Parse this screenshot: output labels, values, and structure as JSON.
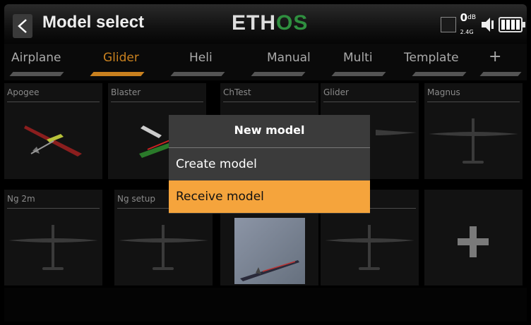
{
  "header": {
    "title": "Model select",
    "logo_main": "ETH",
    "logo_accent": "OS",
    "rf_value": "0",
    "rf_unit": "dB",
    "rf_band": "2.4G"
  },
  "tabs": [
    {
      "label": "Airplane",
      "active": false
    },
    {
      "label": "Glider",
      "active": true
    },
    {
      "label": "Heli",
      "active": false
    },
    {
      "label": "Manual",
      "active": false
    },
    {
      "label": "Multi",
      "active": false
    },
    {
      "label": "Template",
      "active": false
    },
    {
      "label": "+",
      "active": false
    }
  ],
  "models": [
    {
      "name": "Apogee",
      "image": "red-glider-icon"
    },
    {
      "name": "Blaster",
      "image": "green-glider-icon"
    },
    {
      "name": "ChTest",
      "image": "glider-silhouette-icon"
    },
    {
      "name": "Glider",
      "image": "glider-silhouette-icon"
    },
    {
      "name": "Magnus",
      "image": "glider-silhouette-icon"
    },
    {
      "name": "Ng 2m",
      "image": "glider-silhouette-icon"
    },
    {
      "name": "Ng setup",
      "image": "glider-silhouette-icon"
    },
    {
      "name": "",
      "image": "glider-photo"
    },
    {
      "name": "",
      "image": "glider-silhouette-icon"
    }
  ],
  "dialog": {
    "title": "New model",
    "items": [
      {
        "label": "Create model",
        "selected": false
      },
      {
        "label": "Receive model",
        "selected": true
      }
    ]
  },
  "colors": {
    "accent": "#c9811f",
    "selection": "#f5a43c",
    "logo_green": "#2f8f3f"
  }
}
